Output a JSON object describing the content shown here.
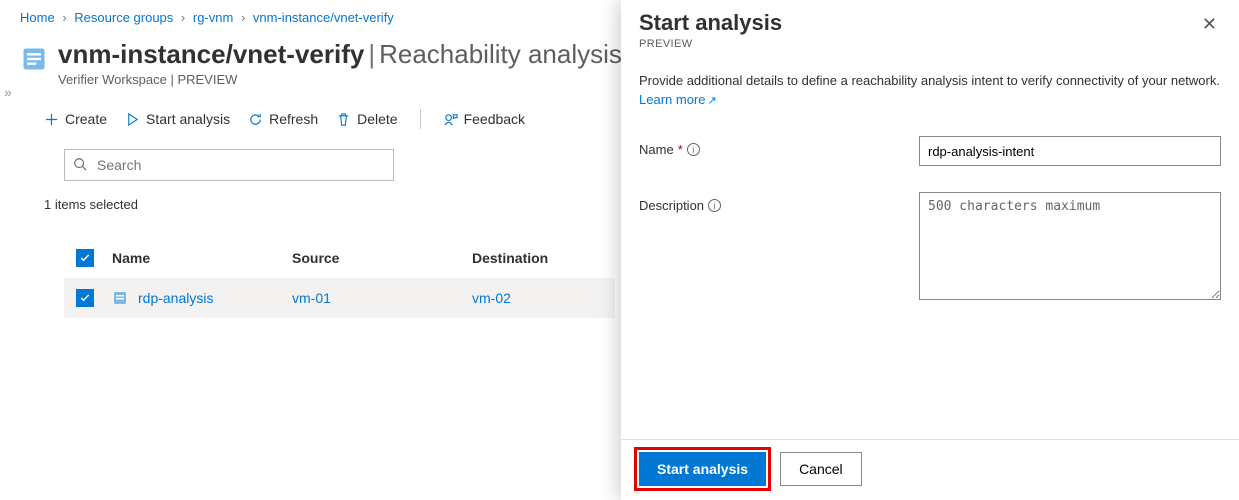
{
  "breadcrumb": {
    "home": "Home",
    "rg": "Resource groups",
    "rg_name": "rg-vnm",
    "resource": "vnm-instance/vnet-verify"
  },
  "header": {
    "title_main": "vnm-instance/vnet-verify",
    "title_section": "Reachability analysis",
    "subtitle": "Verifier Workspace | PREVIEW"
  },
  "toolbar": {
    "create": "Create",
    "start": "Start analysis",
    "refresh": "Refresh",
    "delete": "Delete",
    "feedback": "Feedback"
  },
  "search": {
    "placeholder": "Search"
  },
  "selection_text": "1 items selected",
  "table": {
    "col_name": "Name",
    "col_source": "Source",
    "col_destination": "Destination",
    "rows": [
      {
        "name": "rdp-analysis",
        "source": "vm-01",
        "destination": "vm-02"
      }
    ]
  },
  "panel": {
    "title": "Start analysis",
    "preview": "PREVIEW",
    "description_text": "Provide additional details to define a reachability analysis intent to verify connectivity of your network. ",
    "learn_more": "Learn more",
    "name_label": "Name",
    "name_value": "rdp-analysis-intent",
    "desc_label": "Description",
    "desc_placeholder": "500 characters maximum",
    "btn_start": "Start analysis",
    "btn_cancel": "Cancel"
  }
}
